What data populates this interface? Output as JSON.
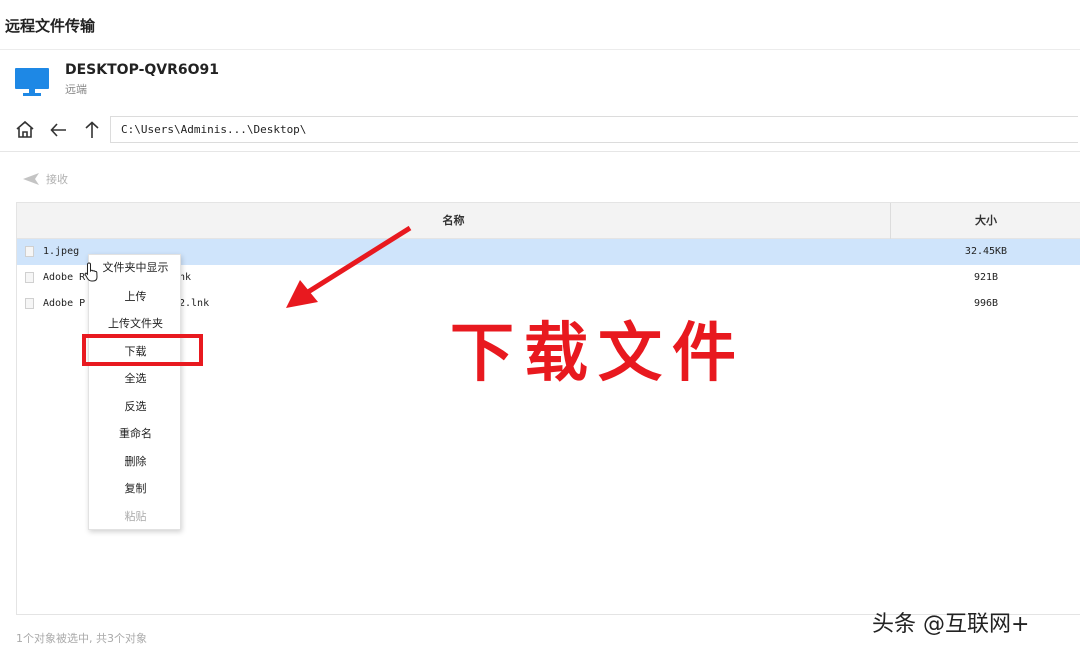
{
  "window": {
    "title": "远程文件传输"
  },
  "device": {
    "name": "DESKTOP-QVR6O91",
    "location": "远端"
  },
  "nav": {
    "home_icon": "home-icon",
    "back_icon": "arrow-left-icon",
    "up_icon": "arrow-up-icon",
    "path": "C:\\Users\\Adminis...\\Desktop\\"
  },
  "toolbar": {
    "receive_label": "接收",
    "receive_icon": "send-back-icon"
  },
  "table": {
    "columns": {
      "name": "名称",
      "size": "大小"
    },
    "rows": [
      {
        "name": "1.jpeg",
        "size": "32.45KB",
        "selected": true
      },
      {
        "name": "Adobe R",
        "name_tail": "nk",
        "size": "921B"
      },
      {
        "name": "Adobe P",
        "name_tail": "2.lnk",
        "size": "996B"
      }
    ]
  },
  "context_menu": {
    "items": [
      "文件夹中显示",
      "上传",
      "上传文件夹",
      "下载",
      "全选",
      "反选",
      "重命名",
      "删除",
      "复制",
      "粘贴"
    ],
    "disabled_index": 9
  },
  "annotation": {
    "text": "下载文件",
    "color": "#e8191f"
  },
  "status": {
    "text": "1个对象被选中, 共3个对象"
  },
  "watermark": {
    "text": "头条 @互联网+"
  },
  "colors": {
    "accent": "#1e88e5",
    "selection": "#cfe4fb",
    "highlight": "#e8191f"
  }
}
